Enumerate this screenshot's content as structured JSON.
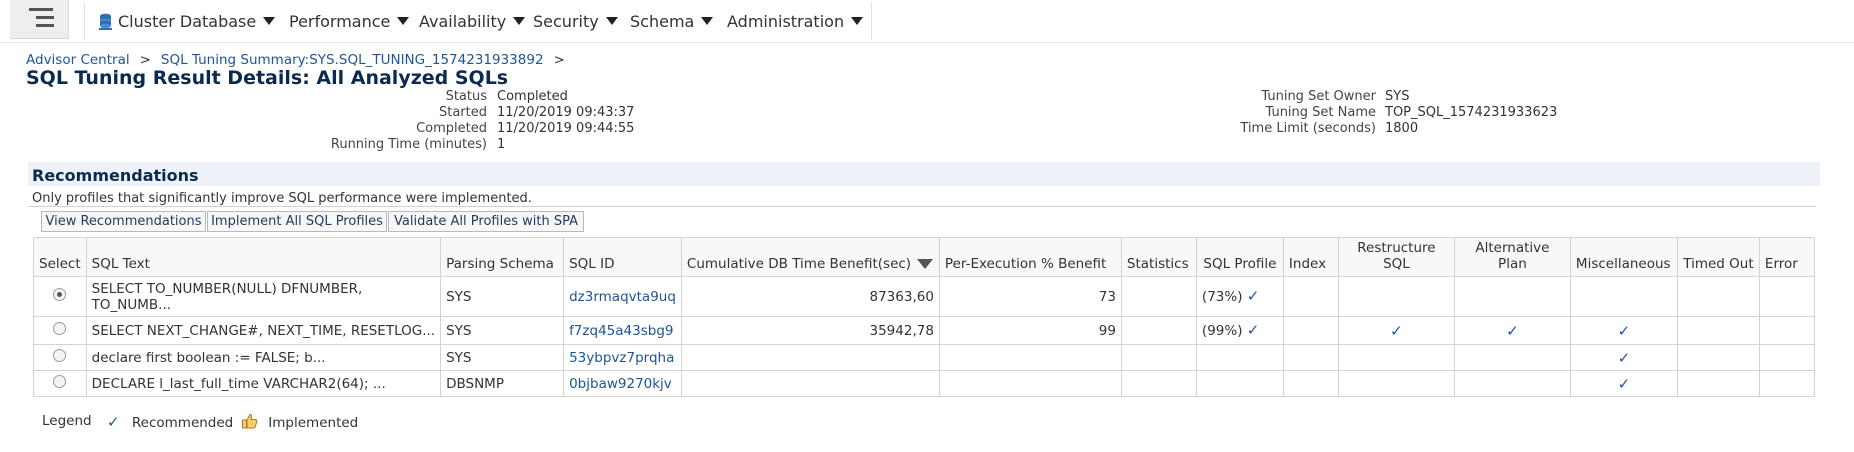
{
  "nav": {
    "items": [
      {
        "label": "Cluster Database"
      },
      {
        "label": "Performance"
      },
      {
        "label": "Availability"
      },
      {
        "label": "Security"
      },
      {
        "label": "Schema"
      },
      {
        "label": "Administration"
      }
    ]
  },
  "breadcrumb": {
    "items": [
      "Advisor Central",
      "SQL Tuning Summary:SYS.SQL_TUNING_1574231933892"
    ],
    "separator": ">"
  },
  "page": {
    "title": "SQL Tuning Result Details: All Analyzed SQLs"
  },
  "details": {
    "left": [
      {
        "label": "Status",
        "value": "Completed"
      },
      {
        "label": "Started",
        "value": "11/20/2019 09:43:37"
      },
      {
        "label": "Completed",
        "value": "11/20/2019 09:44:55"
      },
      {
        "label": "Running Time (minutes)",
        "value": "1"
      }
    ],
    "right": [
      {
        "label": "Tuning Set Owner",
        "value": "SYS"
      },
      {
        "label": "Tuning Set Name",
        "value": "TOP_SQL_1574231933623"
      },
      {
        "label": "Time Limit (seconds)",
        "value": "1800"
      }
    ]
  },
  "recommendations": {
    "title": "Recommendations",
    "note": "Only profiles that significantly improve SQL performance were implemented.",
    "buttons": [
      "View Recommendations",
      "Implement All SQL Profiles",
      "Validate All Profiles with SPA"
    ],
    "columns": [
      "Select",
      "SQL Text",
      "Parsing Schema",
      "SQL ID",
      "Cumulative DB Time Benefit(sec)",
      "Per-Execution % Benefit",
      "Statistics",
      "SQL Profile",
      "Index",
      "Restructure SQL",
      "Alternative Plan",
      "Miscellaneous",
      "Timed Out",
      "Error"
    ],
    "rows": [
      {
        "selected": true,
        "sql_text": "SELECT TO_NUMBER(NULL) DFNUMBER, TO_NUMB...",
        "schema": "SYS",
        "sql_id": "dz3rmaqvta9uq",
        "cum_benefit": "87363,60",
        "per_exec": "73",
        "profile": "(73%)",
        "profile_check": "✓",
        "restructure": "",
        "alternative": "",
        "misc": ""
      },
      {
        "selected": false,
        "sql_text": "SELECT NEXT_CHANGE#, NEXT_TIME, RESETLOG...",
        "schema": "SYS",
        "sql_id": "f7zq45a43sbg9",
        "cum_benefit": "35942,78",
        "per_exec": "99",
        "profile": "(99%)",
        "profile_check": "✓",
        "restructure": "✓",
        "alternative": "✓",
        "misc": "✓"
      },
      {
        "selected": false,
        "sql_text": "declare first boolean := FALSE; b...",
        "schema": "SYS",
        "sql_id": "53ybpvz7prqha",
        "cum_benefit": "",
        "per_exec": "",
        "profile": "",
        "profile_check": "",
        "restructure": "",
        "alternative": "",
        "misc": "✓"
      },
      {
        "selected": false,
        "sql_text": "DECLARE l_last_full_time VARCHAR2(64); ...",
        "schema": "DBSNMP",
        "sql_id": "0bjbaw9270kjv",
        "cum_benefit": "",
        "per_exec": "",
        "profile": "",
        "profile_check": "",
        "restructure": "",
        "alternative": "",
        "misc": "✓"
      }
    ]
  },
  "legend": {
    "title": "Legend",
    "recommended": "Recommended",
    "implemented": "Implemented"
  }
}
